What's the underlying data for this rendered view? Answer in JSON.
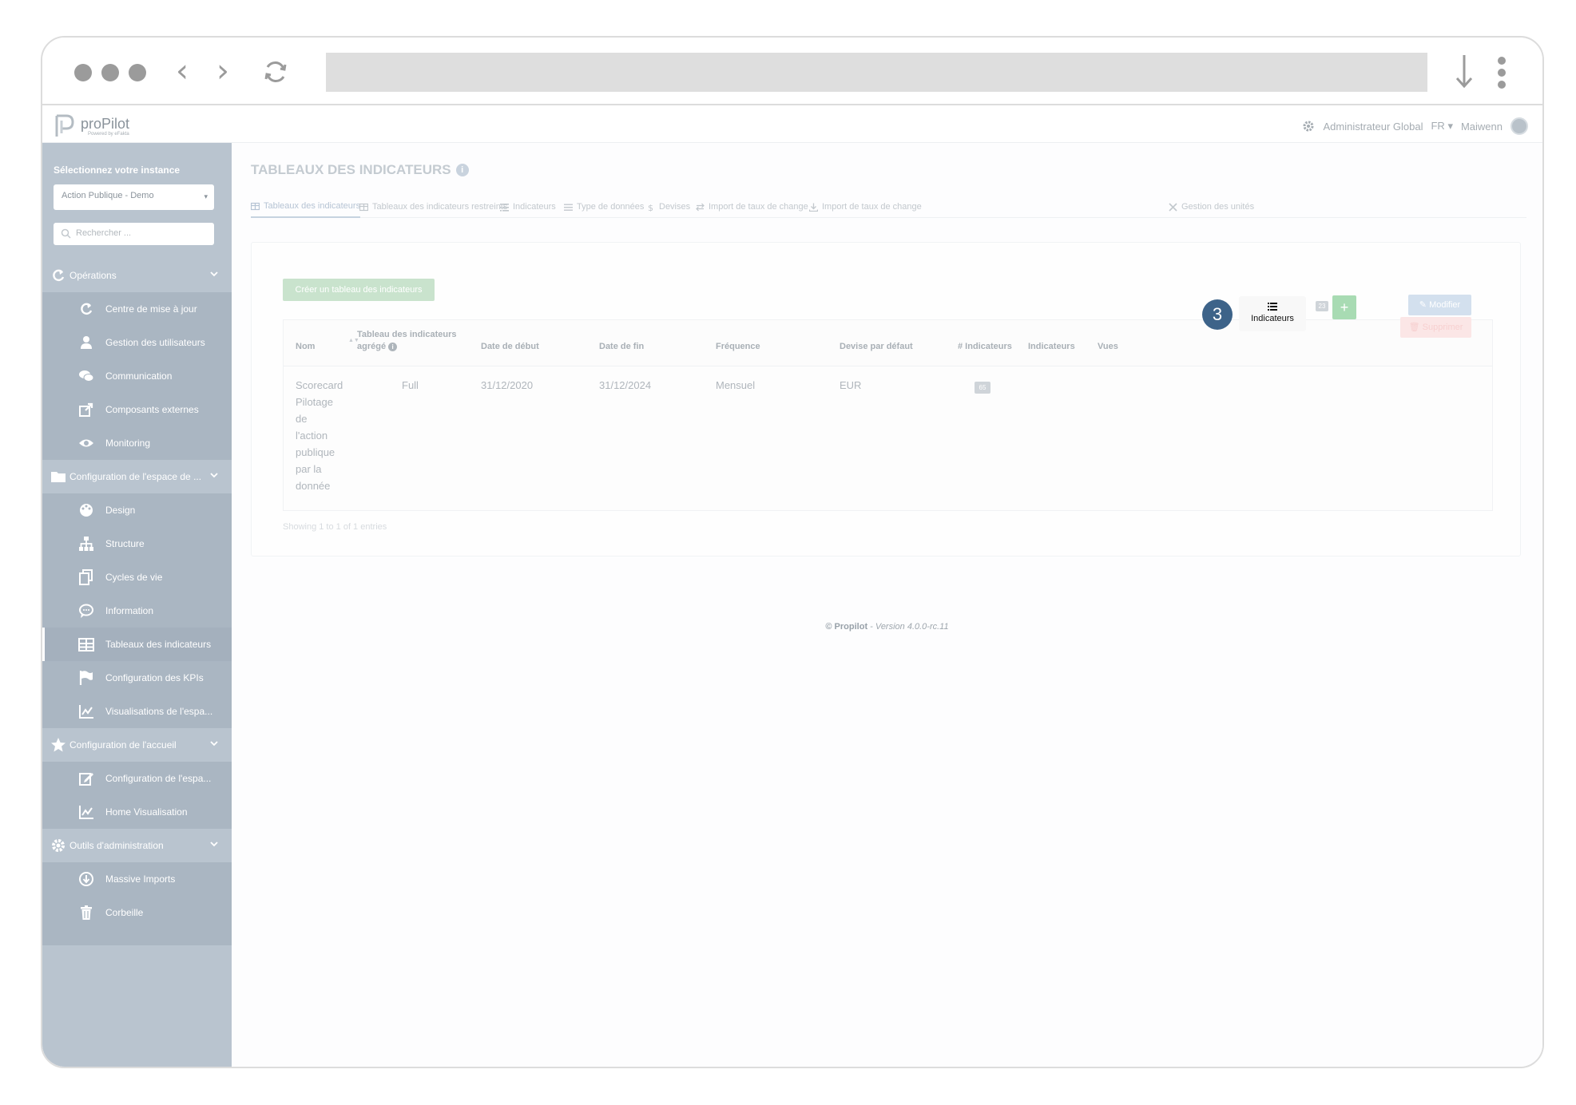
{
  "header": {
    "brand": "proPilot",
    "brand_sub": "Powered by eFakta",
    "user_role": "Administrateur Global",
    "language": "FR",
    "user_name": "Maiwenn"
  },
  "sidebar": {
    "instance_title": "Sélectionnez votre instance",
    "instance_value": "Action Publique - Demo",
    "search_placeholder": "Rechercher ...",
    "items": [
      {
        "label": "Opérations",
        "type": "section",
        "icon": "refresh-icon"
      },
      {
        "label": "Centre de mise à jour",
        "type": "child",
        "icon": "refresh-icon"
      },
      {
        "label": "Gestion des utilisateurs",
        "type": "child",
        "icon": "user-icon"
      },
      {
        "label": "Communication",
        "type": "child",
        "icon": "chat-icon"
      },
      {
        "label": "Composants externes",
        "type": "child",
        "icon": "external-link-icon"
      },
      {
        "label": "Monitoring",
        "type": "child",
        "icon": "eye-icon"
      },
      {
        "label": "Configuration de l'espace de ...",
        "type": "section",
        "icon": "folder-icon"
      },
      {
        "label": "Design",
        "type": "child",
        "icon": "palette-icon"
      },
      {
        "label": "Structure",
        "type": "child",
        "icon": "sitemap-icon"
      },
      {
        "label": "Cycles de vie",
        "type": "child",
        "icon": "copy-icon"
      },
      {
        "label": "Information",
        "type": "child",
        "icon": "comment-icon"
      },
      {
        "label": "Tableaux des indicateurs",
        "type": "child",
        "icon": "table-icon",
        "active": true
      },
      {
        "label": "Configuration des KPIs",
        "type": "child",
        "icon": "flag-icon"
      },
      {
        "label": "Visualisations de l'espa...",
        "type": "child",
        "icon": "chart-icon"
      },
      {
        "label": "Configuration de l'accueil",
        "type": "section",
        "icon": "star-icon"
      },
      {
        "label": "Configuration de l'espa...",
        "type": "child",
        "icon": "edit-icon"
      },
      {
        "label": "Home Visualisation",
        "type": "child",
        "icon": "chart-icon"
      },
      {
        "label": "Outils d'administration",
        "type": "section",
        "icon": "gear-icon"
      },
      {
        "label": "Massive Imports",
        "type": "child",
        "icon": "download-circle-icon"
      },
      {
        "label": "Corbeille",
        "type": "child",
        "icon": "trash-icon"
      }
    ]
  },
  "page": {
    "title": "TABLEAUX DES INDICATEURS",
    "tabs": [
      {
        "label": "Tableaux des indicateurs",
        "icon": "table-icon",
        "active": true
      },
      {
        "label": "Tableaux des indicateurs restreints",
        "icon": "table-icon"
      },
      {
        "label": "Indicateurs",
        "icon": "list-icon"
      },
      {
        "label": "Type de données",
        "icon": "bars-icon"
      },
      {
        "label": "Devises",
        "icon": "dollar-icon"
      },
      {
        "label": "Import de taux de change",
        "icon": "exchange-icon"
      },
      {
        "label": "Import de taux de change",
        "icon": "download-icon"
      },
      {
        "label": "Gestion des unités",
        "icon": "tools-icon"
      }
    ],
    "create_button": "Créer un tableau des indicateurs",
    "table": {
      "headers": {
        "nom": "Nom",
        "agrege_1": "Tableau des indicateurs",
        "agrege_2": "agrégé",
        "date_debut": "Date de début",
        "date_fin": "Date de fin",
        "frequence": "Fréquence",
        "devise": "Devise par défaut",
        "nb_indicateurs": "# Indicateurs",
        "indicateurs": "Indicateurs",
        "vues": "Vues"
      },
      "row": {
        "nom_lines": [
          "Scorecard",
          "Pilotage",
          "de",
          "l'action",
          "publique",
          "par la",
          "donnée"
        ],
        "agrege": "Full",
        "date_debut": "31/12/2020",
        "date_fin": "31/12/2024",
        "frequence": "Mensuel",
        "devise": "EUR",
        "nb_indicateurs": "65",
        "indicateurs_button": "Indicateurs",
        "vues_count": "23",
        "modify_button": "Modifier",
        "delete_button": "Supprimer"
      }
    },
    "step_number": "3",
    "showing": "Showing 1 to 1 of 1 entries",
    "footer_brand": "© Propilot",
    "footer_version": " - Version 4.0.0-rc.11"
  },
  "colors": {
    "sidebar": "#b9c4cf",
    "step_badge": "#3d6389",
    "create_button": "#c9e3cd",
    "plus_button": "#a8dbb3"
  }
}
